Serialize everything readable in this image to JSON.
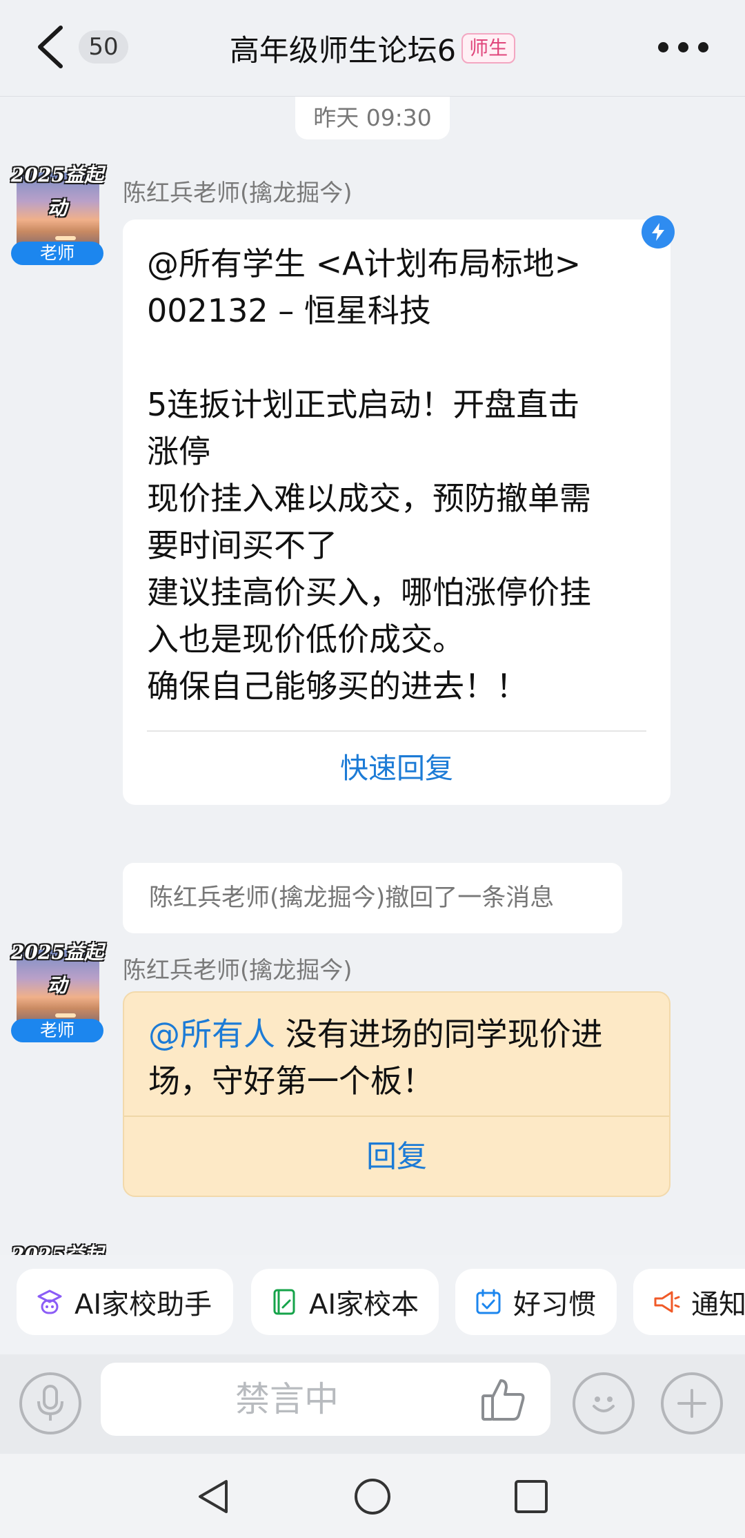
{
  "header": {
    "back_label": "返回",
    "unread_count": "50",
    "title": "高年级师生论坛6",
    "tag": "师生"
  },
  "timestamp": "昨天 09:30",
  "avatar": {
    "banner": "2025益起动",
    "role": "老师"
  },
  "messages": [
    {
      "sender": "陈红兵老师(擒龙掘今)",
      "text": "@所有学生 <A计划布局标地>\n002132 – 恒星科技\n\n5连扳计划正式启动！开盘直击\n涨停\n现价挂入难以成交，预防撤单需\n要时间买不了\n建议挂高价买入，哪怕涨停价挂\n入也是现价低价成交。\n确保自己能够买的进去！！",
      "action": "快速回复"
    },
    {
      "recall_notice": "陈红兵老师(擒龙掘今)撤回了一条消息"
    },
    {
      "sender": "陈红兵老师(擒龙掘今)",
      "mention": "@所有人",
      "text": " 没有进场的同学现价进\n场，守好第一个板！",
      "action": "回复"
    }
  ],
  "shortcuts": [
    {
      "label": "AI家校助手",
      "icon": "ai-assistant-icon"
    },
    {
      "label": "AI家校本",
      "icon": "notebook-icon"
    },
    {
      "label": "好习惯",
      "icon": "calendar-check-icon"
    },
    {
      "label": "通知",
      "icon": "megaphone-icon"
    }
  ],
  "input": {
    "placeholder": "禁言中"
  },
  "colors": {
    "accent": "#1c7bd6",
    "teacher_badge": "#1c86ee",
    "highlight_bubble": "#fde9c6",
    "tag_pink": "#e0457b"
  }
}
